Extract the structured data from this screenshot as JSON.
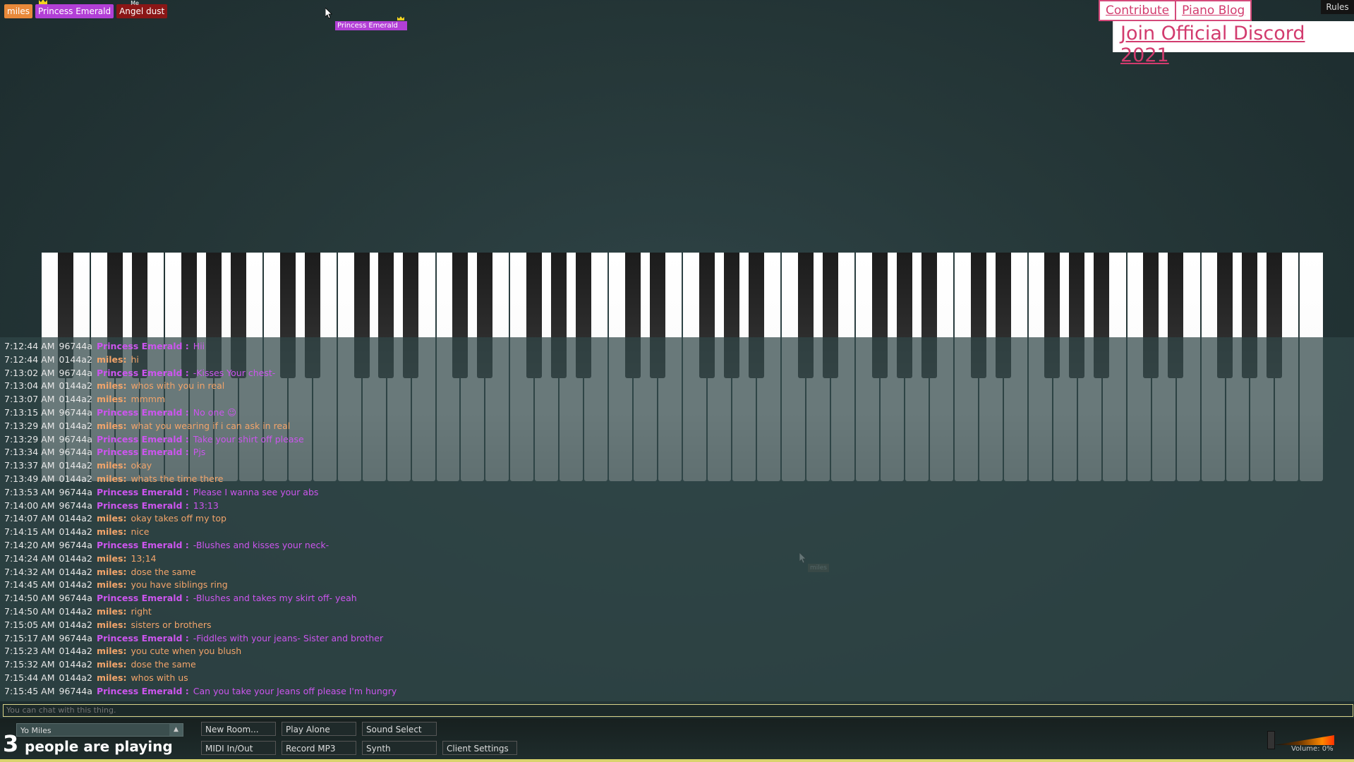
{
  "users": [
    {
      "name": "miles",
      "color": "#e8893a",
      "text_color": "#ffffff",
      "crown": false
    },
    {
      "name": "Princess Emerald",
      "color": "#b23fd6",
      "text_color": "#ffffff",
      "crown": true
    },
    {
      "name": "Angel dust",
      "color": "#8a1616",
      "text_color": "#ffffff",
      "crown": false,
      "overlay": "Me"
    }
  ],
  "cursor_labels": [
    {
      "name": "Princess Emerald",
      "color": "#b23fd6"
    },
    {
      "name": "miles",
      "color": "#6e6250"
    }
  ],
  "top_links": {
    "contribute": "Contribute",
    "piano_blog": "Piano Blog",
    "discord": "Join Official Discord 2021",
    "rules": "Rules"
  },
  "colors": {
    "princess": "#cc55ee",
    "miles": "#f2a46a",
    "accent": "#d23b6e"
  },
  "chat": [
    {
      "time": "7:12:44 AM",
      "id": "96744a",
      "nick": "Princess Emerald :",
      "msg": "Hii",
      "who": "princess"
    },
    {
      "time": "7:12:44 AM",
      "id": "0144a2",
      "nick": "miles:",
      "msg": "hi",
      "who": "miles"
    },
    {
      "time": "7:13:02 AM",
      "id": "96744a",
      "nick": "Princess Emerald :",
      "msg": "-Kisses Your chest-",
      "who": "princess"
    },
    {
      "time": "7:13:04 AM",
      "id": "0144a2",
      "nick": "miles:",
      "msg": "whos with you in real",
      "who": "miles"
    },
    {
      "time": "7:13:07 AM",
      "id": "0144a2",
      "nick": "miles:",
      "msg": "mmmm",
      "who": "miles"
    },
    {
      "time": "7:13:15 AM",
      "id": "96744a",
      "nick": "Princess Emerald :",
      "msg": "No one 😉",
      "who": "princess"
    },
    {
      "time": "7:13:29 AM",
      "id": "0144a2",
      "nick": "miles:",
      "msg": "what you wearing if i can ask in real",
      "who": "miles"
    },
    {
      "time": "7:13:29 AM",
      "id": "96744a",
      "nick": "Princess Emerald :",
      "msg": "Take your shirt off please",
      "who": "princess"
    },
    {
      "time": "7:13:34 AM",
      "id": "96744a",
      "nick": "Princess Emerald :",
      "msg": "Pjs",
      "who": "princess"
    },
    {
      "time": "7:13:37 AM",
      "id": "0144a2",
      "nick": "miles:",
      "msg": "okay",
      "who": "miles"
    },
    {
      "time": "7:13:49 AM",
      "id": "0144a2",
      "nick": "miles:",
      "msg": "whats the time there",
      "who": "miles"
    },
    {
      "time": "7:13:53 AM",
      "id": "96744a",
      "nick": "Princess Emerald :",
      "msg": "Please I wanna see your abs",
      "who": "princess"
    },
    {
      "time": "7:14:00 AM",
      "id": "96744a",
      "nick": "Princess Emerald :",
      "msg": "13:13",
      "who": "princess"
    },
    {
      "time": "7:14:07 AM",
      "id": "0144a2",
      "nick": "miles:",
      "msg": "okay takes off my top",
      "who": "miles"
    },
    {
      "time": "7:14:15 AM",
      "id": "0144a2",
      "nick": "miles:",
      "msg": "nice",
      "who": "miles"
    },
    {
      "time": "7:14:20 AM",
      "id": "96744a",
      "nick": "Princess Emerald :",
      "msg": "-Blushes and kisses your neck-",
      "who": "princess"
    },
    {
      "time": "7:14:24 AM",
      "id": "0144a2",
      "nick": "miles:",
      "msg": "13;14",
      "who": "miles"
    },
    {
      "time": "7:14:32 AM",
      "id": "0144a2",
      "nick": "miles:",
      "msg": "dose the same",
      "who": "miles"
    },
    {
      "time": "7:14:45 AM",
      "id": "0144a2",
      "nick": "miles:",
      "msg": "you have siblings ring",
      "who": "miles"
    },
    {
      "time": "7:14:50 AM",
      "id": "96744a",
      "nick": "Princess Emerald :",
      "msg": "-Blushes and takes my skirt off- yeah",
      "who": "princess"
    },
    {
      "time": "7:14:50 AM",
      "id": "0144a2",
      "nick": "miles:",
      "msg": "right",
      "who": "miles"
    },
    {
      "time": "7:15:05 AM",
      "id": "0144a2",
      "nick": "miles:",
      "msg": "sisters or brothers",
      "who": "miles"
    },
    {
      "time": "7:15:17 AM",
      "id": "96744a",
      "nick": "Princess Emerald :",
      "msg": "-Fiddles with your jeans- Sister and brother",
      "who": "princess"
    },
    {
      "time": "7:15:23 AM",
      "id": "0144a2",
      "nick": "miles:",
      "msg": "you cute when you blush",
      "who": "miles"
    },
    {
      "time": "7:15:32 AM",
      "id": "0144a2",
      "nick": "miles:",
      "msg": "dose the same",
      "who": "miles"
    },
    {
      "time": "7:15:44 AM",
      "id": "0144a2",
      "nick": "miles:",
      "msg": "whos with us",
      "who": "miles"
    },
    {
      "time": "7:15:45 AM",
      "id": "96744a",
      "nick": "Princess Emerald :",
      "msg": "Can you take your Jeans off please I'm hungry",
      "who": "princess"
    }
  ],
  "chat_input": {
    "placeholder": "You can chat with this thing."
  },
  "bottom": {
    "room_name": "Yo Miles",
    "player_count": "3",
    "player_label": "people are playing",
    "buttons": {
      "new_room": "New Room...",
      "play_alone": "Play Alone",
      "sound_select": "Sound Select",
      "midi": "MIDI In/Out",
      "record": "Record MP3",
      "synth": "Synth",
      "client_settings": "Client Settings"
    },
    "volume_label": "Volume: 0%"
  }
}
